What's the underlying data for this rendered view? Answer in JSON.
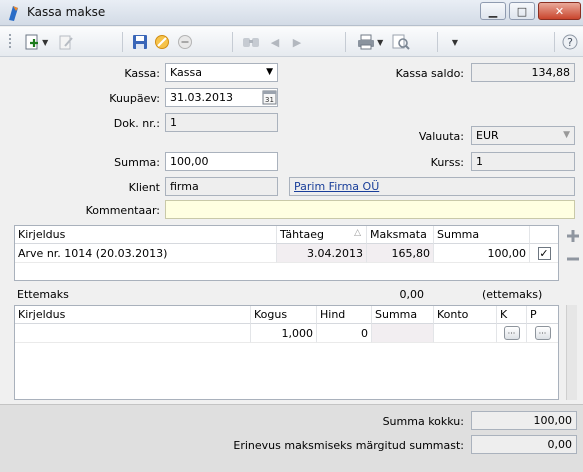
{
  "window": {
    "title": "Kassa makse"
  },
  "form": {
    "kassa_label": "Kassa:",
    "kassa_value": "Kassa",
    "kuupaev_label": "Kuupäev:",
    "kuupaev_value": "31.03.2013",
    "dok_label": "Dok. nr.:",
    "dok_value": "1",
    "summa_label": "Summa:",
    "summa_value": "100,00",
    "klient_label": "Klient",
    "klient_value": "firma",
    "klient_link": "Parim Firma OÜ",
    "kommentaar_label": "Kommentaar:",
    "kommentaar_value": "",
    "kassa_saldo_label": "Kassa saldo:",
    "kassa_saldo_value": "134,88",
    "valuuta_label": "Valuuta:",
    "valuuta_value": "EUR",
    "kurss_label": "Kurss:",
    "kurss_value": "1"
  },
  "invoices": {
    "headers": [
      "Kirjeldus",
      "Tähtaeg",
      "Maksmata",
      "Summa"
    ],
    "rows": [
      {
        "kirjeldus": "Arve nr. 1014 (20.03.2013)",
        "tahtaeg": "3.04.2013",
        "maksmata": "165,80",
        "summa": "100,00",
        "checked": true
      }
    ]
  },
  "ettemaks": {
    "label": "Ettemaks",
    "value": "0,00",
    "note": "(ettemaks)"
  },
  "lines": {
    "headers": [
      "Kirjeldus",
      "Kogus",
      "Hind",
      "Summa",
      "Konto",
      "K",
      "P"
    ],
    "rows": [
      {
        "kirjeldus": "",
        "kogus": "1,000",
        "hind": "0",
        "summa": "",
        "konto": ""
      }
    ]
  },
  "totals": {
    "summa_kokku_label": "Summa kokku:",
    "summa_kokku_value": "100,00",
    "erinevus_label": "Erinevus maksmiseks märgitud summast:",
    "erinevus_value": "0,00"
  },
  "icons": [
    "app-icon",
    "add-icon",
    "edit-icon",
    "save-icon",
    "cancel-icon",
    "delete-icon",
    "find-icon",
    "prev-icon",
    "next-icon",
    "print-icon",
    "preview-icon",
    "help-icon",
    "calendar-icon",
    "plus-icon",
    "minus-icon"
  ],
  "colors": {
    "yellow_field": "#ffffe1",
    "link": "#1a3f9a",
    "close_button": "#c9452d"
  }
}
